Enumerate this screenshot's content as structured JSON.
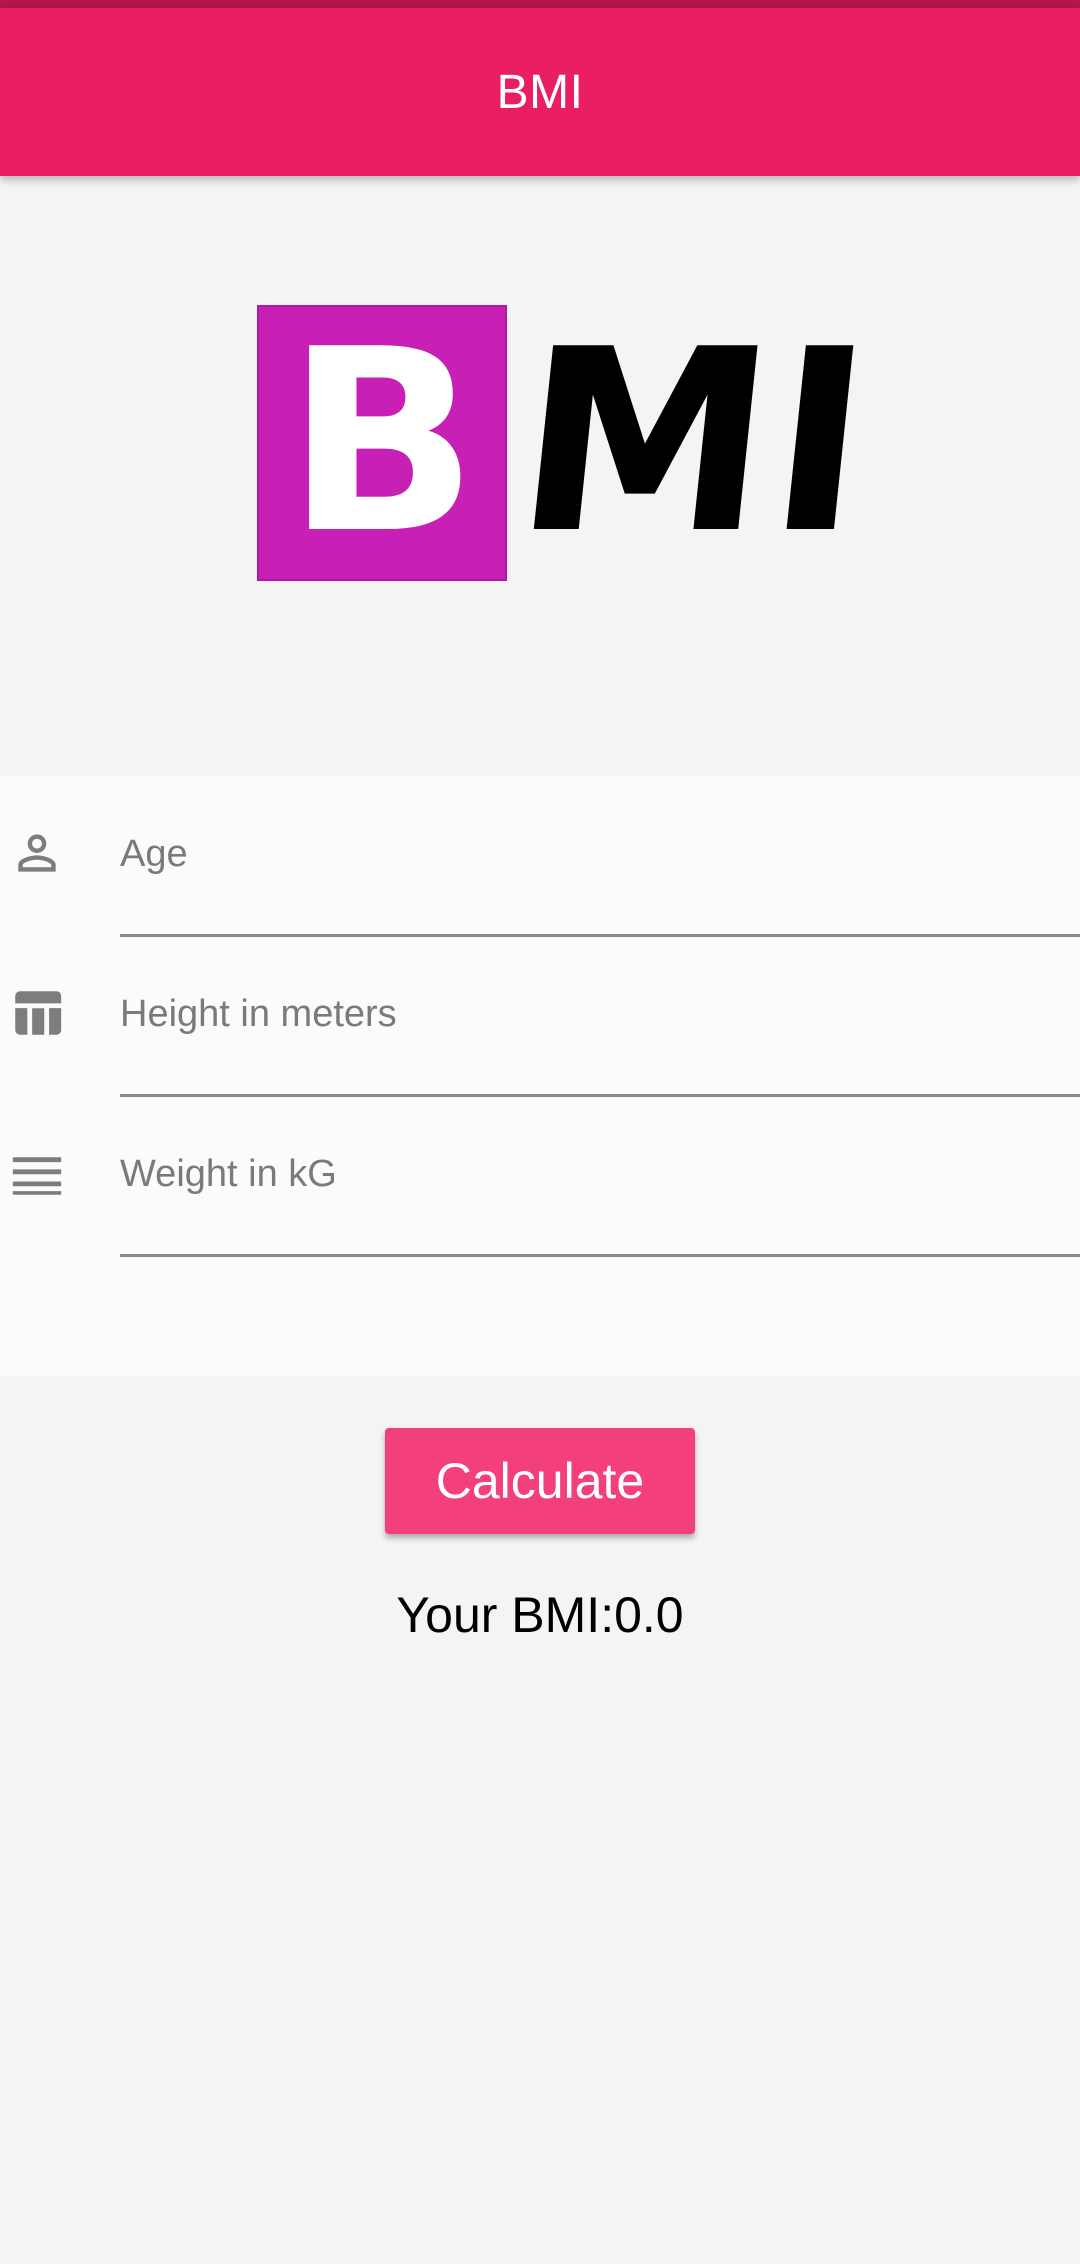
{
  "app_bar": {
    "title": "BMI",
    "color": "#ea1f63"
  },
  "logo": {
    "letter_b": "B",
    "letters_mi": "MI",
    "box_color": "#c81fb6"
  },
  "form": {
    "fields": [
      {
        "icon": "person-icon",
        "placeholder": "Age",
        "value": ""
      },
      {
        "icon": "table-icon",
        "placeholder": "Height in meters",
        "value": ""
      },
      {
        "icon": "lines-icon",
        "placeholder": "Weight in kG",
        "value": ""
      }
    ]
  },
  "calculate_button": {
    "label": "Calculate",
    "color": "#f43f7d"
  },
  "result": {
    "text": "Your BMI:0.0"
  }
}
